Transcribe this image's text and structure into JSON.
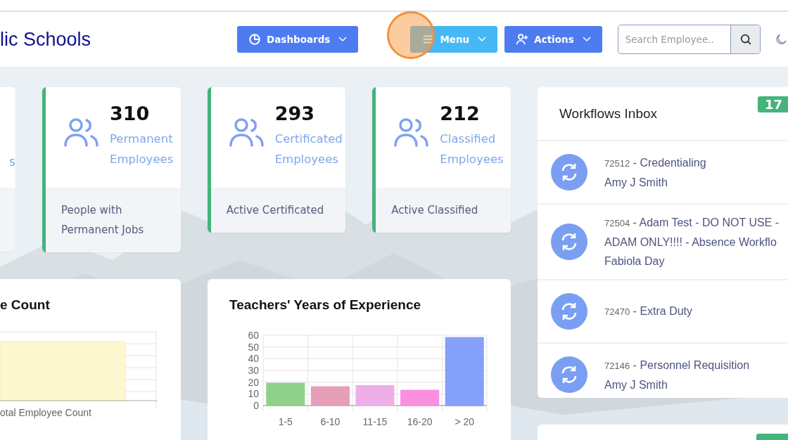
{
  "header": {
    "title": "lic Schools",
    "nav": [
      {
        "label": "Dashboards",
        "color": "#4d7cf1"
      },
      {
        "label": "Menu",
        "color": "#45b8f5"
      },
      {
        "label": "Actions",
        "color": "#4d7cf1"
      }
    ],
    "search": {
      "placeholder": "Search Employee.."
    }
  },
  "stat_cards": [
    {
      "kind": "partial",
      "label": "s"
    },
    {
      "kind": "full",
      "value": "310",
      "label": "Permanent Employees",
      "footer": "People with Permanent Jobs"
    },
    {
      "kind": "full",
      "value": "293",
      "label": "Certificated Employees",
      "footer": "Active Certificated"
    },
    {
      "kind": "full",
      "value": "212",
      "label": "Classified Employees",
      "footer": "Active Classified"
    }
  ],
  "charts": [
    {
      "kind": "partial",
      "title": "e Count",
      "xlabel": "otal Employee Count"
    },
    {
      "kind": "full",
      "title": "Teachers' Years of Experience",
      "chart_data": {
        "type": "bar",
        "categories": [
          "1-5",
          "6-10",
          "11-15",
          "16-20",
          "> 20"
        ],
        "values": [
          19,
          16,
          17,
          13,
          58
        ],
        "grid": true,
        "colors": [
          "#8fd18a",
          "#e5a0b8",
          "#eeaee8",
          "#fb8fe0",
          "#85a0f8"
        ],
        "ylim": [
          0,
          60
        ],
        "yticks": [
          0,
          10,
          20,
          30,
          40,
          50,
          60
        ]
      }
    }
  ],
  "workflows": {
    "title": "Workflows Inbox",
    "badge": "17",
    "items": [
      {
        "id": "72512",
        "title": "- Credentialing",
        "person": "Amy J Smith"
      },
      {
        "id": "72504",
        "title": "- Adam Test - DO NOT USE - ADAM ONLY!!!! - Absence Workflo",
        "person": "Fabiola Day"
      },
      {
        "id": "72470",
        "title": "- Extra Duty"
      },
      {
        "id": "72146",
        "title": "- Personnel Requisition",
        "person": "Amy J Smith"
      }
    ]
  }
}
